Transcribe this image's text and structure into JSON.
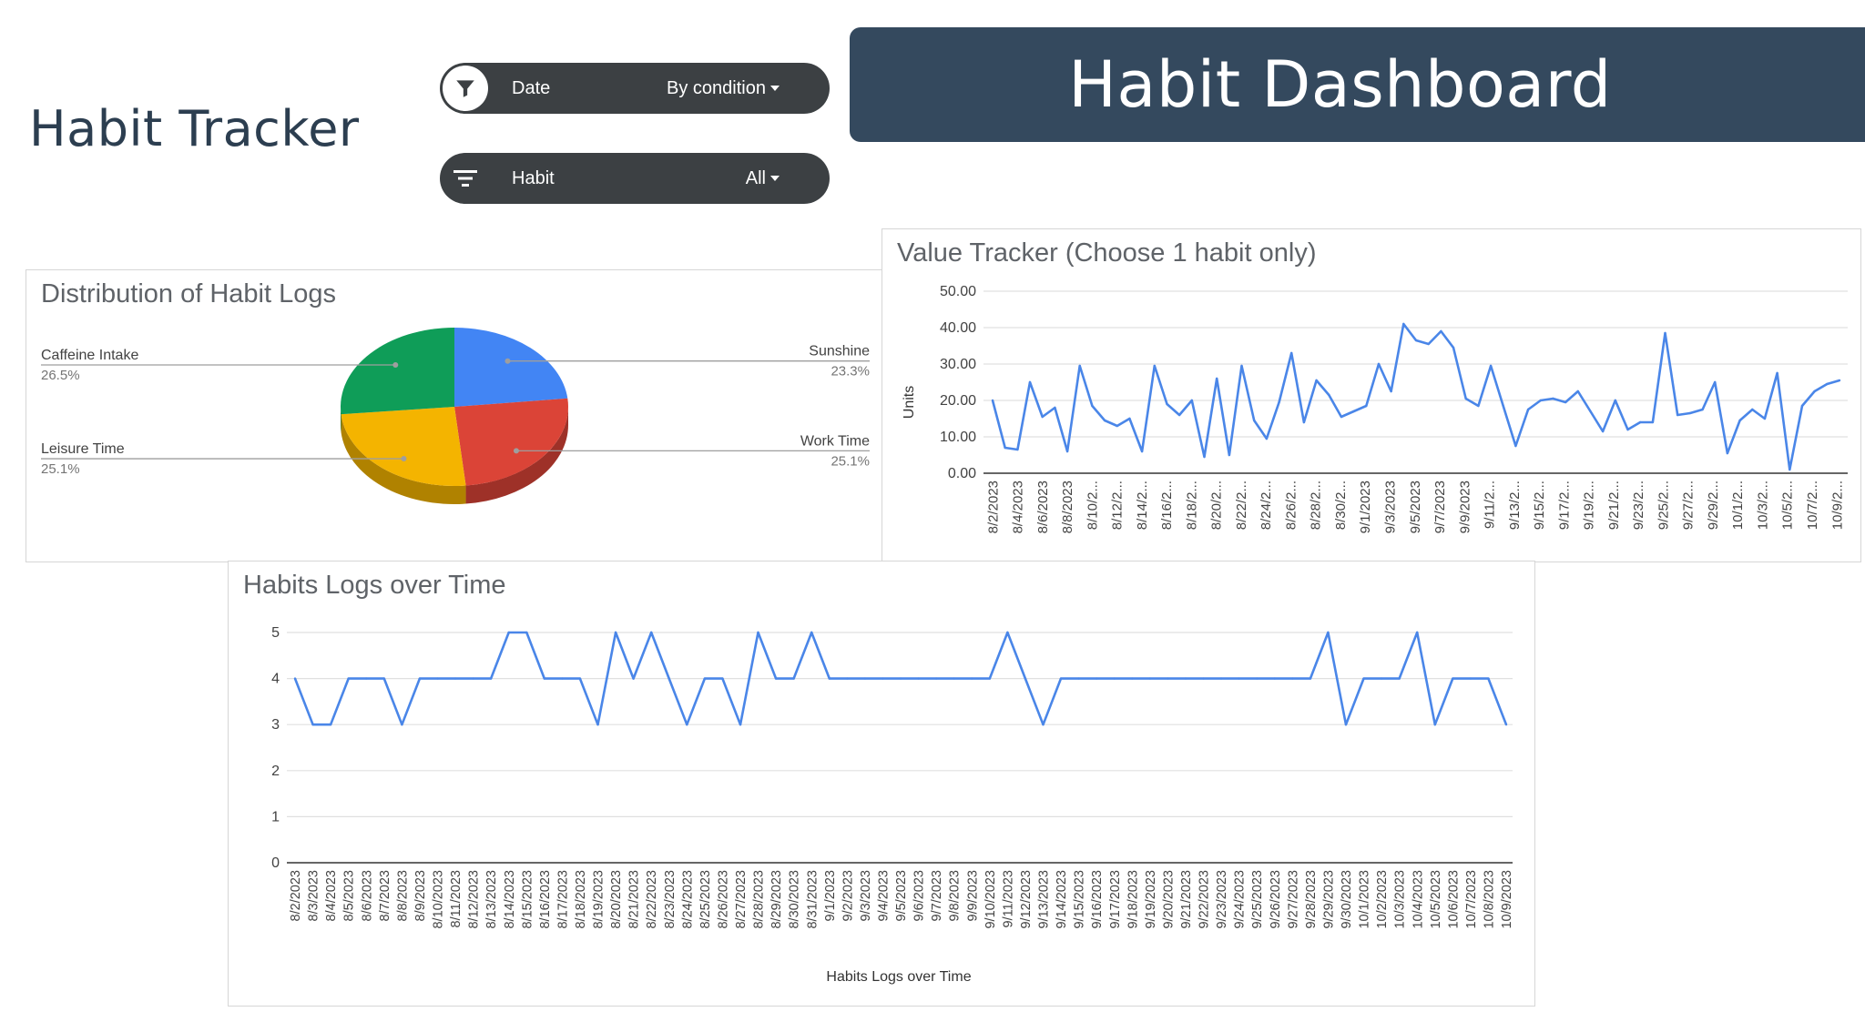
{
  "page_title": "Habit Tracker",
  "banner_title": "Habit Dashboard",
  "filters": [
    {
      "label": "Date",
      "value": "By condition",
      "icon": "filter-funnel-icon"
    },
    {
      "label": "Habit",
      "value": "All",
      "icon": "filter-lines-icon"
    }
  ],
  "colors": {
    "banner": "#34495e",
    "pill": "#3c4043",
    "line": "#4a86e8",
    "pie": [
      "#4285f4",
      "#db4437",
      "#f4b400",
      "#0f9d58"
    ]
  },
  "chart_data": [
    {
      "type": "pie",
      "title": "Distribution of Habit Logs",
      "slices": [
        {
          "label": "Sunshine",
          "pct_label": "23.3%",
          "value": 23.3,
          "color": "#4285f4"
        },
        {
          "label": "Work Time",
          "pct_label": "25.1%",
          "value": 25.1,
          "color": "#db4437"
        },
        {
          "label": "Leisure Time",
          "pct_label": "25.1%",
          "value": 25.1,
          "color": "#f4b400"
        },
        {
          "label": "Caffeine Intake",
          "pct_label": "26.5%",
          "value": 26.5,
          "color": "#0f9d58"
        }
      ],
      "style": "3d"
    },
    {
      "type": "line",
      "title": "Value Tracker (Choose 1 habit only)",
      "ylabel": "Units",
      "ylim": [
        0,
        50
      ],
      "yticks": [
        "0.00",
        "10.00",
        "20.00",
        "30.00",
        "40.00",
        "50.00"
      ],
      "xtick_labels": [
        "8/2/2023",
        "8/4/2023",
        "8/6/2023",
        "8/8/2023",
        "8/10/2...",
        "8/12/2...",
        "8/14/2...",
        "8/16/2...",
        "8/18/2...",
        "8/20/2...",
        "8/22/2...",
        "8/24/2...",
        "8/26/2...",
        "8/28/2...",
        "8/30/2...",
        "9/1/2023",
        "9/3/2023",
        "9/5/2023",
        "9/7/2023",
        "9/9/2023",
        "9/11/2...",
        "9/13/2...",
        "9/15/2...",
        "9/17/2...",
        "9/19/2...",
        "9/21/2...",
        "9/23/2...",
        "9/25/2...",
        "9/27/2...",
        "9/29/2...",
        "10/1/2...",
        "10/3/2...",
        "10/5/2...",
        "10/7/2...",
        "10/9/2..."
      ],
      "values": [
        20,
        7,
        6.5,
        25,
        15.5,
        18,
        6,
        29.5,
        18.5,
        14.5,
        13,
        15,
        6,
        29.5,
        19,
        16,
        20,
        4.5,
        26,
        5,
        29.5,
        14.5,
        9.5,
        19.5,
        33,
        14,
        25.5,
        21.5,
        15.5,
        17,
        18.5,
        30,
        22.5,
        41,
        36.5,
        35.5,
        39,
        34.5,
        20.5,
        18.5,
        29.5,
        18.5,
        7.5,
        17.5,
        20,
        20.5,
        19.5,
        22.5,
        17,
        11.5,
        20,
        12,
        14,
        14,
        38.5,
        16,
        16.5,
        17.5,
        25,
        5.5,
        14.5,
        17.5,
        15,
        27.5,
        1,
        18.5,
        22.5,
        24.5,
        25.5
      ],
      "series_color": "#4a86e8",
      "grid": true
    },
    {
      "type": "line",
      "title": "Habits Logs over Time",
      "xlabel": "Habits Logs over Time",
      "ylim": [
        0,
        5
      ],
      "yticks": [
        "0",
        "1",
        "2",
        "3",
        "4",
        "5"
      ],
      "x": [
        "8/2/2023",
        "8/3/2023",
        "8/4/2023",
        "8/5/2023",
        "8/6/2023",
        "8/7/2023",
        "8/8/2023",
        "8/9/2023",
        "8/10/2023",
        "8/11/2023",
        "8/12/2023",
        "8/13/2023",
        "8/14/2023",
        "8/15/2023",
        "8/16/2023",
        "8/17/2023",
        "8/18/2023",
        "8/19/2023",
        "8/20/2023",
        "8/21/2023",
        "8/22/2023",
        "8/23/2023",
        "8/24/2023",
        "8/25/2023",
        "8/26/2023",
        "8/27/2023",
        "8/28/2023",
        "8/29/2023",
        "8/30/2023",
        "8/31/2023",
        "9/1/2023",
        "9/2/2023",
        "9/3/2023",
        "9/4/2023",
        "9/5/2023",
        "9/6/2023",
        "9/7/2023",
        "9/8/2023",
        "9/9/2023",
        "9/10/2023",
        "9/11/2023",
        "9/12/2023",
        "9/13/2023",
        "9/14/2023",
        "9/15/2023",
        "9/16/2023",
        "9/17/2023",
        "9/18/2023",
        "9/19/2023",
        "9/20/2023",
        "9/21/2023",
        "9/22/2023",
        "9/23/2023",
        "9/24/2023",
        "9/25/2023",
        "9/26/2023",
        "9/27/2023",
        "9/28/2023",
        "9/29/2023",
        "9/30/2023",
        "10/1/2023",
        "10/2/2023",
        "10/3/2023",
        "10/4/2023",
        "10/5/2023",
        "10/6/2023",
        "10/7/2023",
        "10/8/2023",
        "10/9/2023"
      ],
      "values": [
        4,
        3,
        3,
        4,
        4,
        4,
        3,
        4,
        4,
        4,
        4,
        4,
        5,
        5,
        4,
        4,
        4,
        3,
        5,
        4,
        5,
        4,
        3,
        4,
        4,
        3,
        5,
        4,
        4,
        5,
        4,
        4,
        4,
        4,
        4,
        4,
        4,
        4,
        4,
        4,
        5,
        4,
        3,
        4,
        4,
        4,
        4,
        4,
        4,
        4,
        4,
        4,
        4,
        4,
        4,
        4,
        4,
        4,
        5,
        3,
        4,
        4,
        4,
        5,
        3,
        4,
        4,
        4,
        3
      ],
      "series_color": "#4a86e8",
      "grid": true
    }
  ]
}
